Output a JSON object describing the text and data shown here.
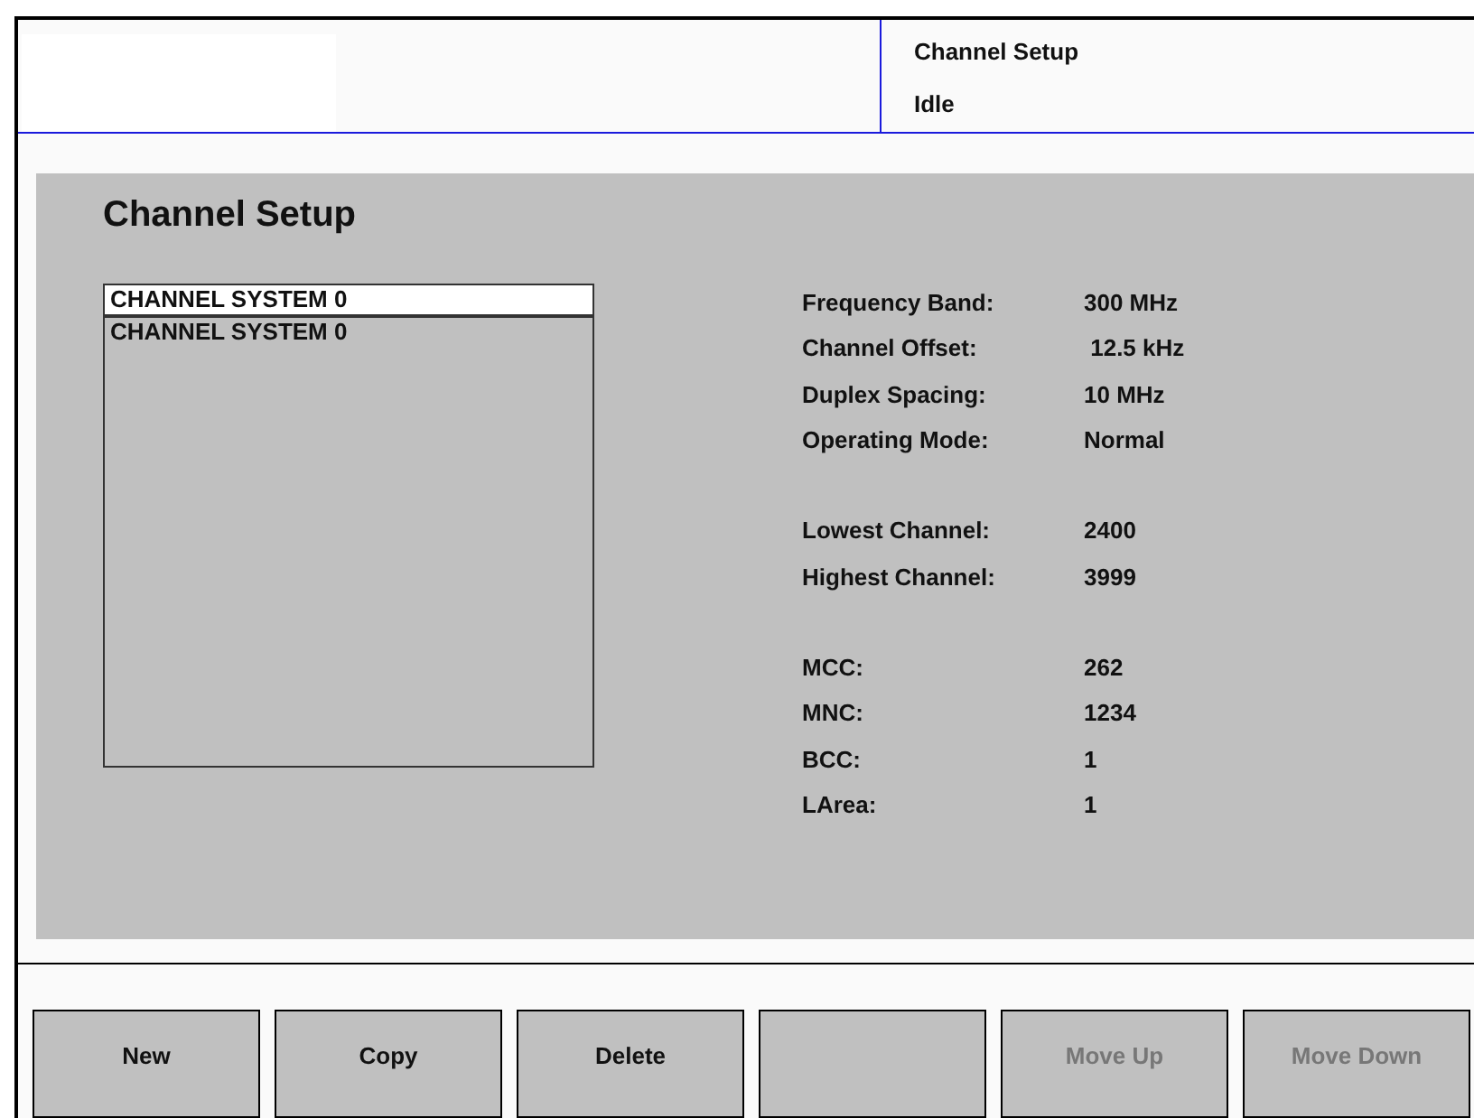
{
  "header": {
    "title": "Channel Setup",
    "status": "Idle"
  },
  "page_title": "Channel Setup",
  "channel_list": [
    {
      "label": "CHANNEL SYSTEM 0",
      "selected": true
    },
    {
      "label": "CHANNEL SYSTEM 0",
      "selected": false
    }
  ],
  "settings": [
    [
      {
        "label": "Frequency Band:",
        "value": "300 MHz"
      },
      {
        "label": "Channel Offset:",
        "value": " 12.5 kHz"
      },
      {
        "label": "Duplex Spacing:",
        "value": "10 MHz"
      },
      {
        "label": "Operating Mode:",
        "value": "Normal"
      }
    ],
    [
      {
        "label": "Lowest Channel:",
        "value": "2400"
      },
      {
        "label": "Highest Channel:",
        "value": "3999"
      }
    ],
    [
      {
        "label": "MCC:",
        "value": "262"
      },
      {
        "label": "MNC:",
        "value": "1234"
      },
      {
        "label": "BCC:",
        "value": "1"
      },
      {
        "label": "LArea:",
        "value": "1"
      }
    ]
  ],
  "buttons": [
    {
      "kind": "text",
      "label": "New",
      "disabled": false
    },
    {
      "kind": "text",
      "label": "Copy",
      "disabled": false
    },
    {
      "kind": "text",
      "label": "Delete",
      "disabled": false
    },
    {
      "kind": "blank"
    },
    {
      "kind": "text",
      "label": "Move Up",
      "disabled": true
    },
    {
      "kind": "text",
      "label": "Move Down",
      "disabled": true
    }
  ]
}
